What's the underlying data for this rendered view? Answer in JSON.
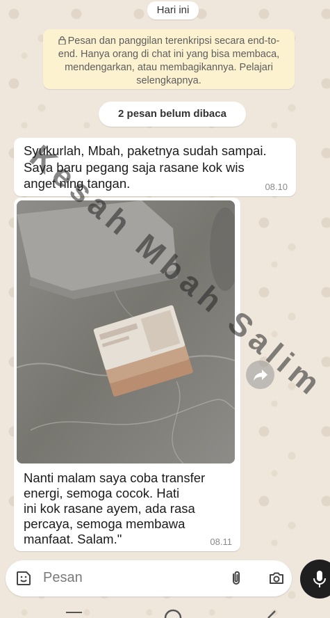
{
  "date_pill": "Hari ini",
  "encryption_notice": "Pesan dan panggilan terenkripsi secara end-to-end. Hanya orang di chat ini yang bisa membaca, mendengarkan, atau membagikannya. Pelajari selengkapnya.",
  "unread_pill": "2 pesan belum dibaca",
  "messages": [
    {
      "text": "Syukurlah, Mbah, paketnya sudah sampai.\nSaya baru pegang saja rasane kok wis\nanget ning tangan.",
      "time": "08.10"
    },
    {
      "caption": "Nanti malam saya coba transfer\nenergi, semoga cocok. Hati\nini kok rasane ayem, ada rasa\npercaya, semoga membawa\nmanfaat. Salam.\"",
      "time": "08.11"
    }
  ],
  "watermark": "Kesah Mbah Salim",
  "composer": {
    "placeholder": "Pesan",
    "icons": [
      "sticker-icon",
      "attach-icon",
      "camera-icon",
      "mic-icon"
    ]
  },
  "colors": {
    "wallpaper": "#efe7dc",
    "banner": "#fdf2d0",
    "mic_button": "#1f1f1f"
  }
}
